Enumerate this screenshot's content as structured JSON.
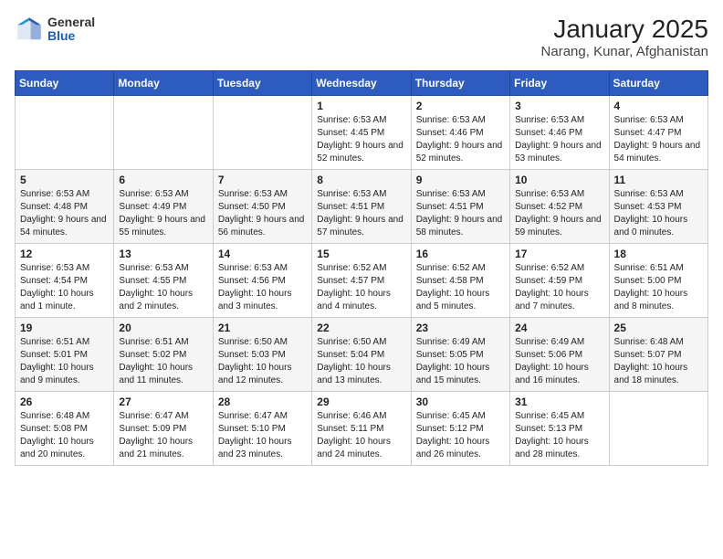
{
  "header": {
    "logo_general": "General",
    "logo_blue": "Blue",
    "title": "January 2025",
    "subtitle": "Narang, Kunar, Afghanistan"
  },
  "days_of_week": [
    "Sunday",
    "Monday",
    "Tuesday",
    "Wednesday",
    "Thursday",
    "Friday",
    "Saturday"
  ],
  "weeks": [
    [
      {
        "day": "",
        "info": ""
      },
      {
        "day": "",
        "info": ""
      },
      {
        "day": "",
        "info": ""
      },
      {
        "day": "1",
        "info": "Sunrise: 6:53 AM\nSunset: 4:45 PM\nDaylight: 9 hours and 52 minutes."
      },
      {
        "day": "2",
        "info": "Sunrise: 6:53 AM\nSunset: 4:46 PM\nDaylight: 9 hours and 52 minutes."
      },
      {
        "day": "3",
        "info": "Sunrise: 6:53 AM\nSunset: 4:46 PM\nDaylight: 9 hours and 53 minutes."
      },
      {
        "day": "4",
        "info": "Sunrise: 6:53 AM\nSunset: 4:47 PM\nDaylight: 9 hours and 54 minutes."
      }
    ],
    [
      {
        "day": "5",
        "info": "Sunrise: 6:53 AM\nSunset: 4:48 PM\nDaylight: 9 hours and 54 minutes."
      },
      {
        "day": "6",
        "info": "Sunrise: 6:53 AM\nSunset: 4:49 PM\nDaylight: 9 hours and 55 minutes."
      },
      {
        "day": "7",
        "info": "Sunrise: 6:53 AM\nSunset: 4:50 PM\nDaylight: 9 hours and 56 minutes."
      },
      {
        "day": "8",
        "info": "Sunrise: 6:53 AM\nSunset: 4:51 PM\nDaylight: 9 hours and 57 minutes."
      },
      {
        "day": "9",
        "info": "Sunrise: 6:53 AM\nSunset: 4:51 PM\nDaylight: 9 hours and 58 minutes."
      },
      {
        "day": "10",
        "info": "Sunrise: 6:53 AM\nSunset: 4:52 PM\nDaylight: 9 hours and 59 minutes."
      },
      {
        "day": "11",
        "info": "Sunrise: 6:53 AM\nSunset: 4:53 PM\nDaylight: 10 hours and 0 minutes."
      }
    ],
    [
      {
        "day": "12",
        "info": "Sunrise: 6:53 AM\nSunset: 4:54 PM\nDaylight: 10 hours and 1 minute."
      },
      {
        "day": "13",
        "info": "Sunrise: 6:53 AM\nSunset: 4:55 PM\nDaylight: 10 hours and 2 minutes."
      },
      {
        "day": "14",
        "info": "Sunrise: 6:53 AM\nSunset: 4:56 PM\nDaylight: 10 hours and 3 minutes."
      },
      {
        "day": "15",
        "info": "Sunrise: 6:52 AM\nSunset: 4:57 PM\nDaylight: 10 hours and 4 minutes."
      },
      {
        "day": "16",
        "info": "Sunrise: 6:52 AM\nSunset: 4:58 PM\nDaylight: 10 hours and 5 minutes."
      },
      {
        "day": "17",
        "info": "Sunrise: 6:52 AM\nSunset: 4:59 PM\nDaylight: 10 hours and 7 minutes."
      },
      {
        "day": "18",
        "info": "Sunrise: 6:51 AM\nSunset: 5:00 PM\nDaylight: 10 hours and 8 minutes."
      }
    ],
    [
      {
        "day": "19",
        "info": "Sunrise: 6:51 AM\nSunset: 5:01 PM\nDaylight: 10 hours and 9 minutes."
      },
      {
        "day": "20",
        "info": "Sunrise: 6:51 AM\nSunset: 5:02 PM\nDaylight: 10 hours and 11 minutes."
      },
      {
        "day": "21",
        "info": "Sunrise: 6:50 AM\nSunset: 5:03 PM\nDaylight: 10 hours and 12 minutes."
      },
      {
        "day": "22",
        "info": "Sunrise: 6:50 AM\nSunset: 5:04 PM\nDaylight: 10 hours and 13 minutes."
      },
      {
        "day": "23",
        "info": "Sunrise: 6:49 AM\nSunset: 5:05 PM\nDaylight: 10 hours and 15 minutes."
      },
      {
        "day": "24",
        "info": "Sunrise: 6:49 AM\nSunset: 5:06 PM\nDaylight: 10 hours and 16 minutes."
      },
      {
        "day": "25",
        "info": "Sunrise: 6:48 AM\nSunset: 5:07 PM\nDaylight: 10 hours and 18 minutes."
      }
    ],
    [
      {
        "day": "26",
        "info": "Sunrise: 6:48 AM\nSunset: 5:08 PM\nDaylight: 10 hours and 20 minutes."
      },
      {
        "day": "27",
        "info": "Sunrise: 6:47 AM\nSunset: 5:09 PM\nDaylight: 10 hours and 21 minutes."
      },
      {
        "day": "28",
        "info": "Sunrise: 6:47 AM\nSunset: 5:10 PM\nDaylight: 10 hours and 23 minutes."
      },
      {
        "day": "29",
        "info": "Sunrise: 6:46 AM\nSunset: 5:11 PM\nDaylight: 10 hours and 24 minutes."
      },
      {
        "day": "30",
        "info": "Sunrise: 6:45 AM\nSunset: 5:12 PM\nDaylight: 10 hours and 26 minutes."
      },
      {
        "day": "31",
        "info": "Sunrise: 6:45 AM\nSunset: 5:13 PM\nDaylight: 10 hours and 28 minutes."
      },
      {
        "day": "",
        "info": ""
      }
    ]
  ]
}
